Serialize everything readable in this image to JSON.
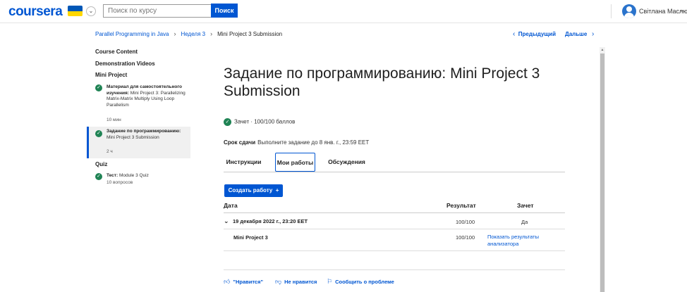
{
  "header": {
    "logo": "coursera",
    "search_placeholder": "Поиск по курсу",
    "search_button": "Поиск",
    "user_name": "Світлана Маслюк",
    "flag_colors": [
      "#0057b7",
      "#ffd700"
    ]
  },
  "breadcrumb": {
    "items": [
      "Parallel Programming in Java",
      "Неделя 3",
      "Mini Project 3 Submission"
    ],
    "prev": "Предыдущий",
    "next": "Дальше"
  },
  "sidebar": {
    "sections": [
      "Course Content",
      "Demonstration Videos",
      "Mini Project",
      "Quiz"
    ],
    "items": [
      {
        "type": "Материал для самостоятельного изучения:",
        "name": "Mini Project 3: Parallelizing Matrix-Matrix Multiply Using Loop Parallelism",
        "meta": "10 мин"
      },
      {
        "type": "Задание по программированию:",
        "name": "Mini Project 3 Submission",
        "meta": "2 ч"
      },
      {
        "type": "Тест:",
        "name": "Module 3 Quiz",
        "meta": "10 вопросов"
      }
    ]
  },
  "main": {
    "title": "Задание по программированию: Mini Project 3 Submission",
    "status": "Зачет · 100/100 баллов",
    "due_label": "Срок сдачи",
    "due_text": "Выполните задание до 8 янв. г., 23:59 EET",
    "tabs": [
      "Инструкции",
      "Мои работы",
      "Обсуждения"
    ],
    "create_button": "Создать работу",
    "table": {
      "headers": [
        "Дата",
        "Результат",
        "Зачет"
      ],
      "submission": {
        "date": "19 декабря 2022 г., 23:20 EET",
        "result": "100/100",
        "pass": "Да"
      },
      "part": {
        "name": "Mini Project 3",
        "result": "100/100",
        "link": "Показать результаты анализатора"
      }
    },
    "feedback": [
      "\"Нравится\"",
      "Не нравится",
      "Сообщить о проблеме"
    ]
  },
  "colors": {
    "accent": "#0056d2",
    "success": "#1f8354"
  }
}
